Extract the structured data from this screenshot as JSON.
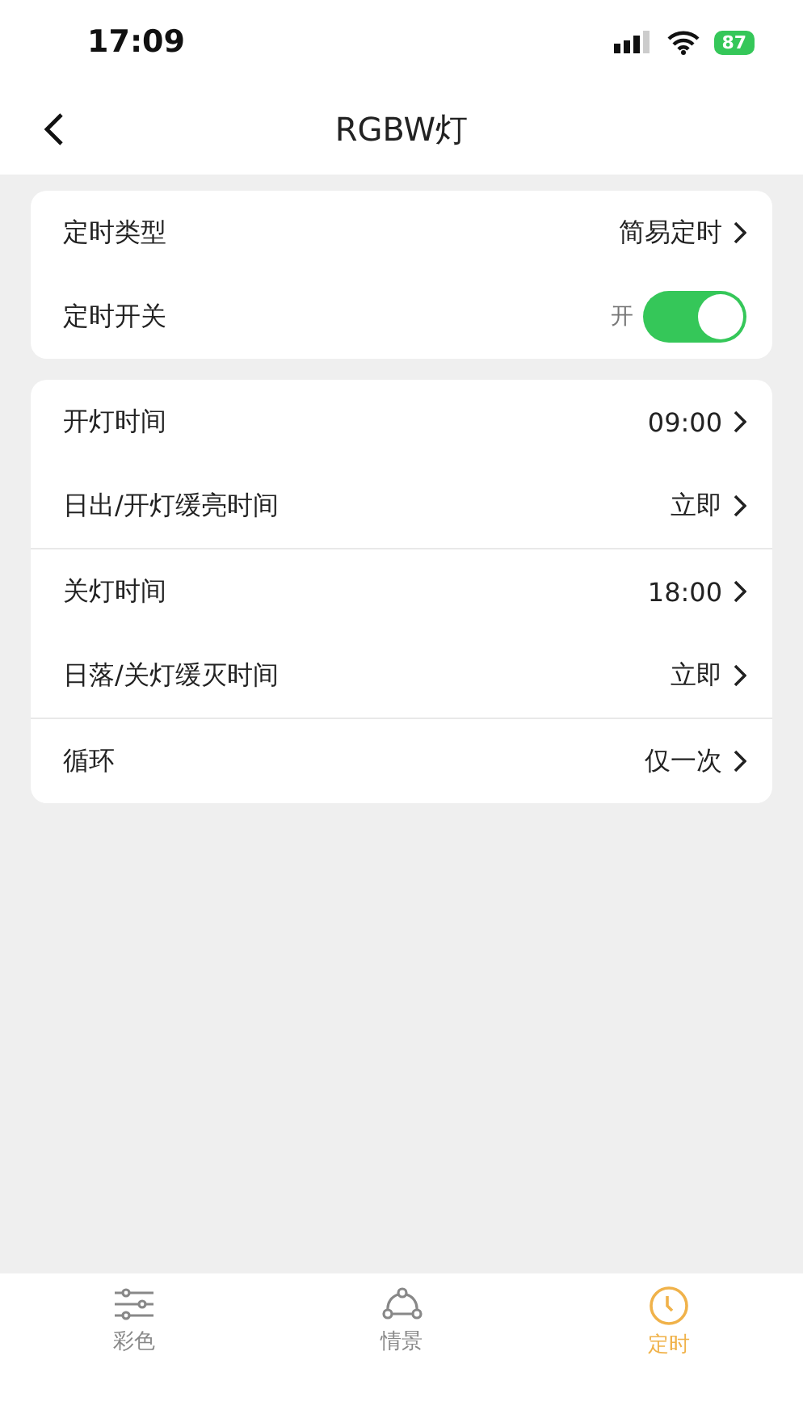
{
  "status_bar": {
    "time": "17:09",
    "battery": "87"
  },
  "nav": {
    "title": "RGBW灯"
  },
  "cards": [
    {
      "groups": [
        [
          {
            "kind": "link",
            "label": "定时类型",
            "value": "简易定时"
          },
          {
            "kind": "switch",
            "label": "定时开关",
            "value": "开",
            "on": true
          }
        ]
      ]
    },
    {
      "groups": [
        [
          {
            "kind": "link",
            "label": "开灯时间",
            "value": "09:00"
          },
          {
            "kind": "link",
            "label": "日出/开灯缓亮时间",
            "value": "立即"
          }
        ],
        [
          {
            "kind": "link",
            "label": "关灯时间",
            "value": "18:00"
          },
          {
            "kind": "link",
            "label": "日落/关灯缓灭时间",
            "value": "立即"
          }
        ],
        [
          {
            "kind": "link",
            "label": "循环",
            "value": "仅一次"
          }
        ]
      ]
    }
  ],
  "tab_bar": [
    {
      "label": "彩色",
      "selected": false
    },
    {
      "label": "情景",
      "selected": false
    },
    {
      "label": "定时",
      "selected": true
    }
  ]
}
